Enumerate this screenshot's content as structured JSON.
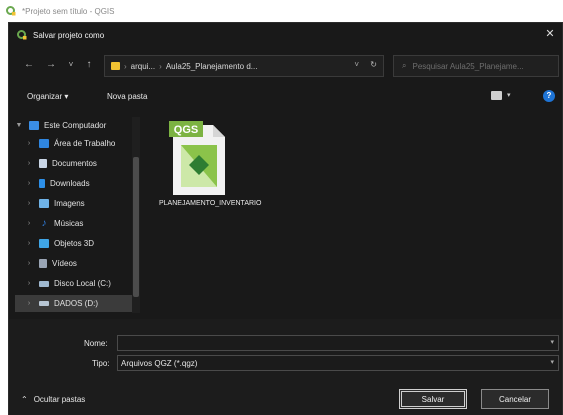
{
  "app": {
    "window_title": "*Projeto sem título - QGIS"
  },
  "dialog": {
    "title": "Salvar projeto como",
    "close_glyph": "✕"
  },
  "nav": {
    "back_glyph": "←",
    "forward_glyph": "→",
    "dropdown_glyph": "˅",
    "up_glyph": "↑",
    "breadcrumb": [
      "arqui...",
      "Aula25_Planejamento d..."
    ],
    "refresh_glyph": "↻",
    "search_placeholder": "Pesquisar Aula25_Planejame..."
  },
  "toolbar": {
    "organize_label": "Organizar ▾",
    "new_folder_label": "Nova pasta",
    "help_label": "?"
  },
  "sidebar": {
    "items": [
      {
        "label": "Este Computador",
        "icon": "computer-icon",
        "color": "#3a8ee6"
      },
      {
        "label": "Área de Trabalho",
        "icon": "desktop-icon",
        "color": "#2f86e0"
      },
      {
        "label": "Documentos",
        "icon": "documents-icon",
        "color": "#c9d6e6"
      },
      {
        "label": "Downloads",
        "icon": "downloads-icon",
        "color": "#2d8fe8"
      },
      {
        "label": "Imagens",
        "icon": "images-icon",
        "color": "#6fb3e8"
      },
      {
        "label": "Músicas",
        "icon": "music-icon",
        "color": "#2f7fe0"
      },
      {
        "label": "Objetos 3D",
        "icon": "objects-3d-icon",
        "color": "#3fa5e6"
      },
      {
        "label": "Vídeos",
        "icon": "videos-icon",
        "color": "#9aa5b5"
      },
      {
        "label": "Disco Local (C:)",
        "icon": "drive-icon",
        "color": "#9fb8cf"
      },
      {
        "label": "DADOS (D:)",
        "icon": "drive-icon",
        "color": "#b8c6d4"
      }
    ]
  },
  "files": [
    {
      "name": "PLANEJAMENTO_INVENTARIO",
      "badge": "QGS"
    }
  ],
  "form": {
    "name_label": "Nome:",
    "name_value": "",
    "type_label": "Tipo:",
    "type_value": "Arquivos QGZ (*.qgz)"
  },
  "footer": {
    "hide_folders_label": "Ocultar pastas",
    "save_label": "Salvar",
    "cancel_label": "Cancelar"
  },
  "colors": {
    "dialog_bg": "#191919",
    "qgis_green": "#7cb342",
    "accent_blue": "#1e74d6"
  }
}
